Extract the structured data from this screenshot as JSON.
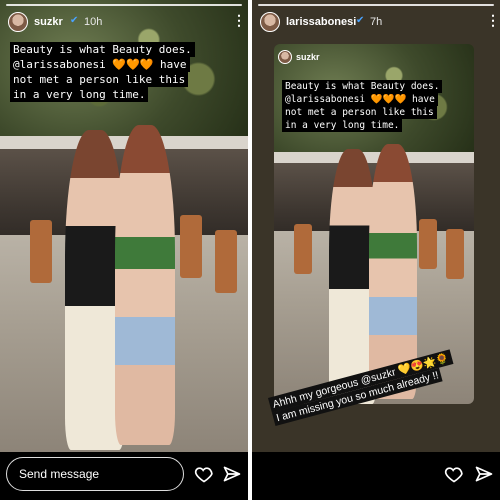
{
  "left": {
    "username": "suzkr",
    "time": "10h",
    "caption_lines": [
      "Beauty is what Beauty does.",
      "@larissabonesi 🧡🧡🧡 have",
      "not met a person like this",
      "in a very long time."
    ],
    "message_placeholder": "Send message",
    "icons": [
      "heart-icon",
      "send-icon",
      "more-options-icon"
    ]
  },
  "right": {
    "username": "larissabonesi",
    "time": "7h",
    "inner_username": "suzkr",
    "caption_lines": [
      "Beauty is what Beauty does.",
      "@larissabonesi 🧡🧡🧡 have",
      "not met a person like this",
      "in a very long time."
    ],
    "sticker_lines": [
      "Ahhh my gorgeous @suzkr 💛😍🌟🌻",
      "I am missing you so much already !!"
    ],
    "icons": [
      "heart-icon",
      "send-icon",
      "more-options-icon"
    ]
  }
}
